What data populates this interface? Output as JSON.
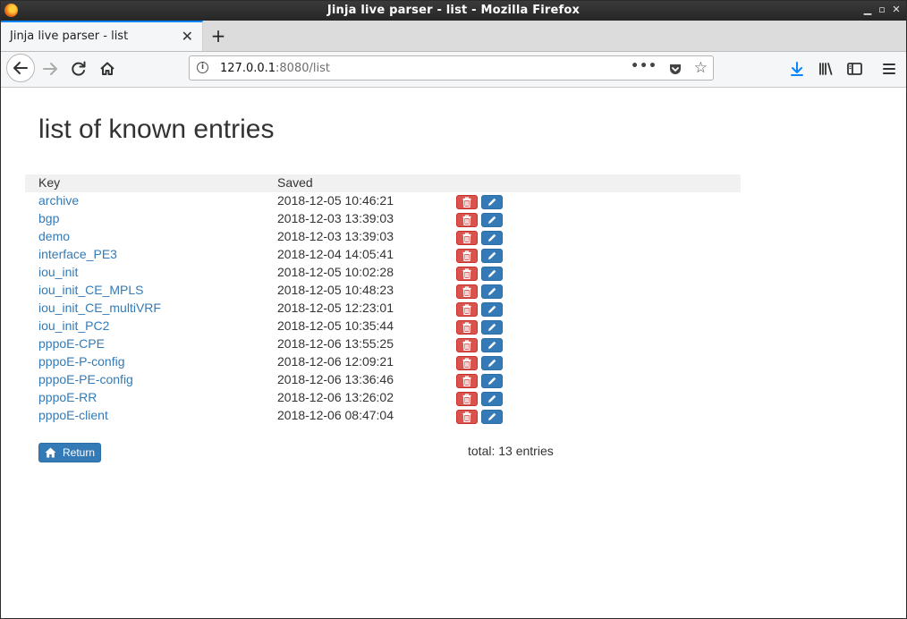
{
  "window": {
    "title": "Jinja live parser - list - Mozilla Firefox",
    "minimize_glyph": "▁",
    "maximize_glyph": "▫",
    "close_glyph": "✕"
  },
  "tab": {
    "label": "Jinja live parser - list",
    "close_glyph": "✕",
    "new_tab_glyph": "+"
  },
  "urlbar": {
    "host": "127.0.0.1",
    "rest": ":8080/list",
    "menu_dots": "•••"
  },
  "page": {
    "title": "list of known entries",
    "columns": {
      "key": "Key",
      "saved": "Saved"
    },
    "entries": [
      {
        "key": "archive",
        "saved": "2018-12-05 10:46:21"
      },
      {
        "key": "bgp",
        "saved": "2018-12-03 13:39:03"
      },
      {
        "key": "demo",
        "saved": "2018-12-03 13:39:03"
      },
      {
        "key": "interface_PE3",
        "saved": "2018-12-04 14:05:41"
      },
      {
        "key": "iou_init",
        "saved": "2018-12-05 10:02:28"
      },
      {
        "key": "iou_init_CE_MPLS",
        "saved": "2018-12-05 10:48:23"
      },
      {
        "key": "iou_init_CE_multiVRF",
        "saved": "2018-12-05 12:23:01"
      },
      {
        "key": "iou_init_PC2",
        "saved": "2018-12-05 10:35:44"
      },
      {
        "key": "pppoE-CPE",
        "saved": "2018-12-06 13:55:25"
      },
      {
        "key": "pppoE-P-config",
        "saved": "2018-12-06 12:09:21"
      },
      {
        "key": "pppoE-PE-config",
        "saved": "2018-12-06 13:36:46"
      },
      {
        "key": "pppoE-RR",
        "saved": "2018-12-06 13:26:02"
      },
      {
        "key": "pppoE-client",
        "saved": "2018-12-06 08:47:04"
      }
    ],
    "return_label": "Return",
    "total": "total: 13 entries"
  },
  "colors": {
    "link": "#337ab7",
    "danger": "#d9534f",
    "primary": "#337ab7",
    "accent_tab": "#0a84ff"
  }
}
